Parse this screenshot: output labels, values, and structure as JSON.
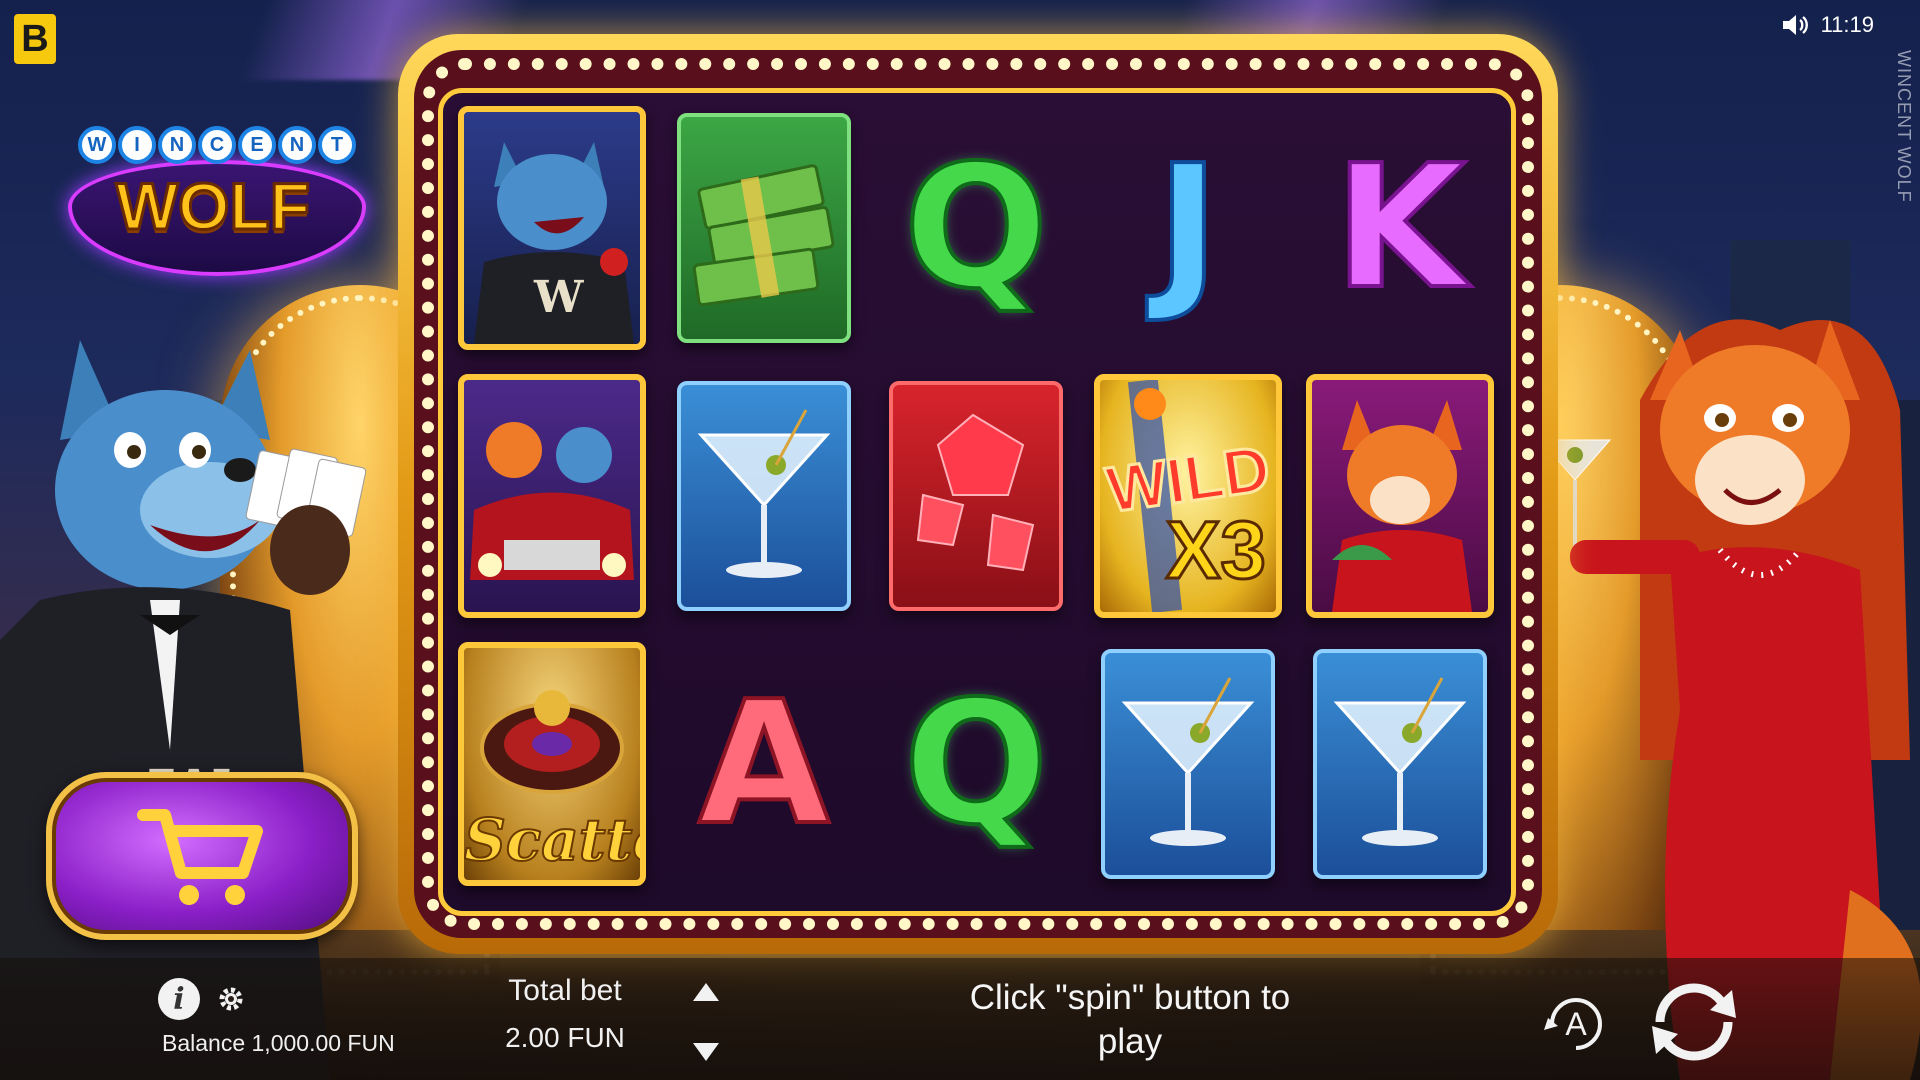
{
  "brand": {
    "badge": "B"
  },
  "status": {
    "time": "11:19",
    "side_title": "WINCENT WOLF"
  },
  "logo": {
    "top_letters": [
      "W",
      "I",
      "N",
      "C",
      "E",
      "N",
      "T"
    ],
    "main": "WOLF"
  },
  "reels": {
    "rows": [
      [
        {
          "kind": "character-wolf"
        },
        {
          "kind": "cash"
        },
        {
          "kind": "letter",
          "text": "Q",
          "color": "green"
        },
        {
          "kind": "letter",
          "text": "J",
          "color": "blue"
        },
        {
          "kind": "letter",
          "text": "K",
          "color": "pink"
        }
      ],
      [
        {
          "kind": "car"
        },
        {
          "kind": "martini"
        },
        {
          "kind": "diamonds"
        },
        {
          "kind": "wild",
          "label": "WILD",
          "multiplier": "X3"
        },
        {
          "kind": "character-fox"
        }
      ],
      [
        {
          "kind": "scatter",
          "label": "Scatter"
        },
        {
          "kind": "letter",
          "text": "A",
          "color": "red"
        },
        {
          "kind": "letter",
          "text": "Q",
          "color": "green"
        },
        {
          "kind": "martini"
        },
        {
          "kind": "martini"
        }
      ]
    ]
  },
  "bottom": {
    "balance": "Balance 1,000.00 FUN",
    "total_bet_label": "Total bet",
    "total_bet_value": "2.00 FUN",
    "hint": "Click \"spin\" button to play",
    "auto_label": "A"
  },
  "colors": {
    "frame_gold": "#ffc83a",
    "shop_purple": "#8a1fc7",
    "reel_bg": "#1e0a2a"
  },
  "icons": [
    "speaker-icon",
    "cart-icon",
    "info-icon",
    "gear-icon",
    "arrow-up-icon",
    "arrow-down-icon",
    "autoplay-icon",
    "spin-icon"
  ]
}
